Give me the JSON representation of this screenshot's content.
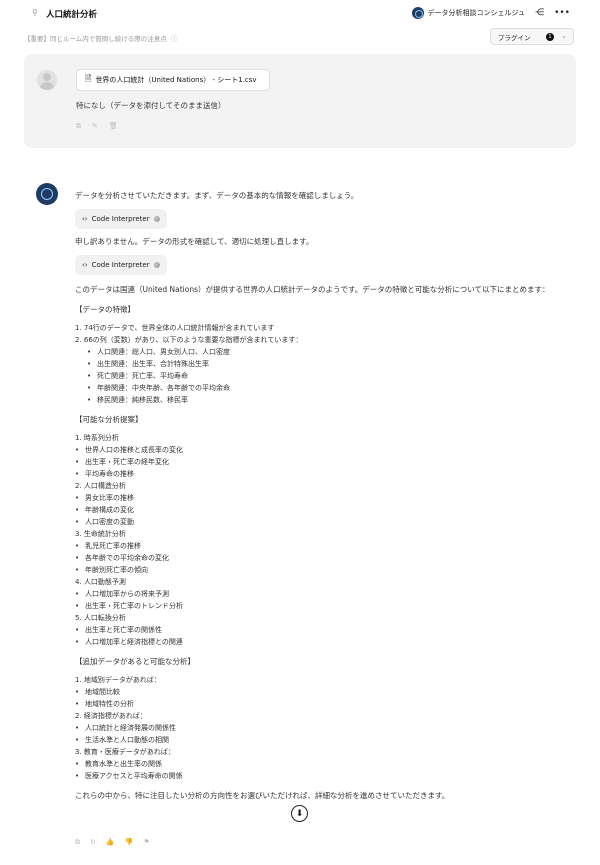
{
  "header": {
    "room_title": "人口統計分析",
    "bot_name": "データ分析相談コンシェルジュ"
  },
  "subbar": {
    "notice": "【重要】同じルーム内で質問し続ける際の注意点",
    "plugin_label": "プラグイン",
    "plugin_badge": "1"
  },
  "user_message": {
    "file_name": "世界の人口統計（United Nations） - シート1.csv",
    "text": "特になし（データを添付してそのまま送信）"
  },
  "bot_message": {
    "intro": "データを分析させていただきます。まず、データの基本的な情報を確認しましょう。",
    "tool_label_1": "Code Interpreter",
    "apology": "申し訳ありません。データの形式を確認して、適切に処理し直します。",
    "tool_label_2": "Code Interpreter",
    "summary": "このデータは国連（United Nations）が提供する世界の人口統計データのようです。データの特徴と可能な分析について以下にまとめます：",
    "features_heading": "【データの特徴】",
    "features": {
      "item1": "1. 74行のデータで、世界全体の人口統計情報が含まれています",
      "item2": "2. 66の列（変数）があり、以下のような重要な指標が含まれています：",
      "sub": [
        "人口関連：総人口、男女別人口、人口密度",
        "出生関連：出生率、合計特殊出生率",
        "死亡関連：死亡率、平均寿命",
        "年齢関連：中央年齢、各年齢での平均余命",
        "移民関連：純移民数、移民率"
      ]
    },
    "analysis_heading": "【可能な分析提案】",
    "analysis": {
      "g1": "1. 時系列分析",
      "g1_items": [
        "世界人口の推移と成長率の変化",
        "出生率・死亡率の経年変化",
        "平均寿命の推移"
      ],
      "g2": "2. 人口構造分析",
      "g2_items": [
        "男女比率の推移",
        "年齢構成の変化",
        "人口密度の変動"
      ],
      "g3": "3. 生命統計分析",
      "g3_items": [
        "乳児死亡率の推移",
        "各年齢での平均余命の変化",
        "年齢別死亡率の傾向"
      ],
      "g4": "4. 人口動態予測",
      "g4_items": [
        "人口増加率からの将来予測",
        "出生率・死亡率のトレンド分析"
      ],
      "g5": "5. 人口転換分析",
      "g5_items": [
        "出生率と死亡率の関係性",
        "人口増加率と経済指標との関連"
      ]
    },
    "extra_heading": "【追加データがあると可能な分析】",
    "extra": {
      "g1": "1. 地域別データがあれば：",
      "g1_items": [
        "地域間比較",
        "地域特性の分析"
      ],
      "g2": "2. 経済指標があれば：",
      "g2_items": [
        "人口統計と経済発展の関係性",
        "生活水準と人口動態の相関"
      ],
      "g3": "3. 教育・医療データがあれば：",
      "g3_items": [
        "教育水準と出生率の関係",
        "医療アクセスと平均寿命の関係"
      ]
    },
    "closing": "これらの中から、特に注目したい分析の方向性をお選びいただければ、詳細な分析を進めさせていただきます。"
  }
}
